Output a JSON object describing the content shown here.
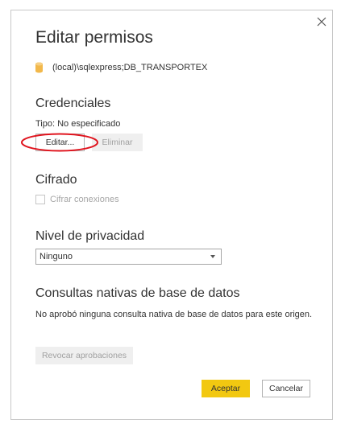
{
  "dialog": {
    "title": "Editar permisos",
    "source_path": "(local)\\sqlexpress;DB_TRANSPORTEX",
    "close_icon": "close-icon"
  },
  "credentials": {
    "heading": "Credenciales",
    "type_text": "Tipo: No especificado",
    "edit_label": "Editar...",
    "delete_label": "Eliminar"
  },
  "encryption": {
    "heading": "Cifrado",
    "checkbox_label": "Cifrar conexiones",
    "checked": false
  },
  "privacy": {
    "heading": "Nivel de privacidad",
    "selected": "Ninguno"
  },
  "native_queries": {
    "heading": "Consultas nativas de base de datos",
    "description": "No aprobó ninguna consulta nativa de base de datos para este origen.",
    "revoke_label": "Revocar aprobaciones"
  },
  "footer": {
    "accept_label": "Aceptar",
    "cancel_label": "Cancelar"
  },
  "colors": {
    "accent": "#f2c811",
    "annotation": "#e0141e",
    "db_icon": "#f2b84b"
  }
}
